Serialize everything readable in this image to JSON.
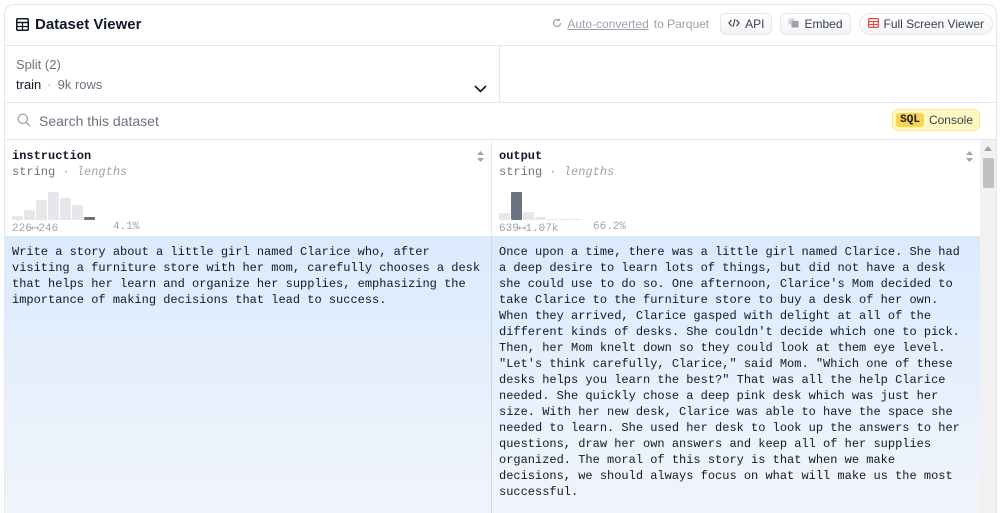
{
  "header": {
    "title": "Dataset Viewer",
    "auto_converted_link": "Auto-converted",
    "auto_converted_suffix": "to Parquet",
    "api_label": "API",
    "embed_label": "Embed",
    "full_screen_label": "Full Screen Viewer"
  },
  "split": {
    "label": "Split (2)",
    "value": "train",
    "separator": "·",
    "rows": "9k rows"
  },
  "search": {
    "placeholder": "Search this dataset",
    "sql_tag": "SQL",
    "sql_label": "Console"
  },
  "columns": [
    {
      "name": "instruction",
      "type": "string",
      "type_note": "· lengths",
      "hist_min": "226",
      "hist_max": "246",
      "hist_range": "226⟷246",
      "hist_pct": "4.1%",
      "hist_bars": [
        0.15,
        0.35,
        0.7,
        1.0,
        0.8,
        0.55,
        0.12
      ],
      "highlight_index": 6
    },
    {
      "name": "output",
      "type": "string",
      "type_note": "· lengths",
      "hist_range": "639⟷1.07k",
      "hist_pct": "66.2%",
      "hist_bars": [
        0.25,
        1.0,
        0.3,
        0.12,
        0.05,
        0.02,
        0.01
      ],
      "highlight_index": 1
    }
  ],
  "rows": [
    {
      "instruction": "Write a story about a little girl named Clarice who, after\nvisiting a furniture store with her mom, carefully chooses a desk\nthat helps her learn and organize her supplies, emphasizing the\nimportance of making decisions that lead to success.",
      "output": "Once upon a time, there was a little girl named Clarice. She had\na deep desire to learn lots of things, but did not have a desk\nshe could use to do so. One afternoon, Clarice's Mom decided to\ntake Clarice to the furniture store to buy a desk of her own.\nWhen they arrived, Clarice gasped with delight at all of the\ndifferent kinds of desks. She couldn't decide which one to pick.\nThen, her Mom knelt down so they could look at them eye level.\n\"Let's think carefully, Clarice,\" said Mom. \"Which one of these\ndesks helps you learn the best?\" That was all the help Clarice\nneeded. She quickly chose a deep pink desk which was just her\nsize. With her new desk, Clarice was able to have the space she\nneeded to learn. She used her desk to look up the answers to her\nquestions, draw her own answers and keep all of her supplies\norganized. The moral of this story is that when we make\ndecisions, we should always focus on what will make us the most\nsuccessful."
    }
  ],
  "colors": {
    "row_highlight": "#dbeafe",
    "hist_bar": "#e5e7eb",
    "hist_highlight": "#6b7280",
    "sql_bg": "#fef9c3",
    "full_screen_icon": "#ef4444"
  }
}
